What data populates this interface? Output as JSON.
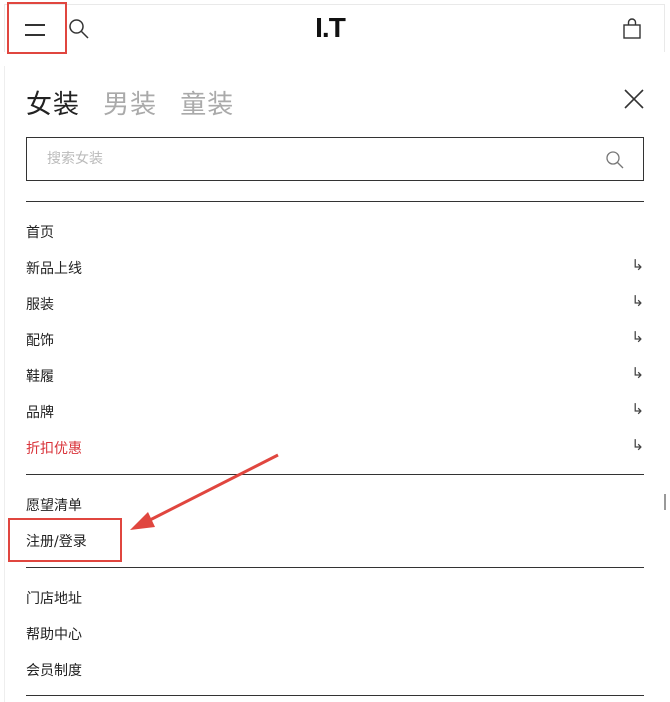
{
  "header": {
    "logo": "I.T",
    "menu_icon": "hamburger-menu-icon",
    "search_icon": "search-icon",
    "bag_icon": "shopping-bag-icon"
  },
  "drawer": {
    "tabs": [
      {
        "label": "女装",
        "active": true
      },
      {
        "label": "男装",
        "active": false
      },
      {
        "label": "童装",
        "active": false
      }
    ],
    "search_placeholder": "搜索女装",
    "primary_nav": [
      {
        "label": "首页",
        "has_arrow": false
      },
      {
        "label": "新品上线",
        "has_arrow": true
      },
      {
        "label": "服装",
        "has_arrow": true
      },
      {
        "label": "配饰",
        "has_arrow": true
      },
      {
        "label": "鞋履",
        "has_arrow": true
      },
      {
        "label": "品牌",
        "has_arrow": true
      },
      {
        "label": "折扣优惠",
        "has_arrow": true
      }
    ],
    "account_nav": [
      {
        "label": "愿望清单"
      },
      {
        "label": "注册/登录"
      }
    ],
    "info_nav": [
      {
        "label": "门店地址"
      },
      {
        "label": "帮助中心"
      },
      {
        "label": "会员制度"
      }
    ],
    "arrow_glyph": "↳"
  },
  "colors": {
    "sale_red": "#d9333a",
    "annotation_red": "#e0463f"
  }
}
